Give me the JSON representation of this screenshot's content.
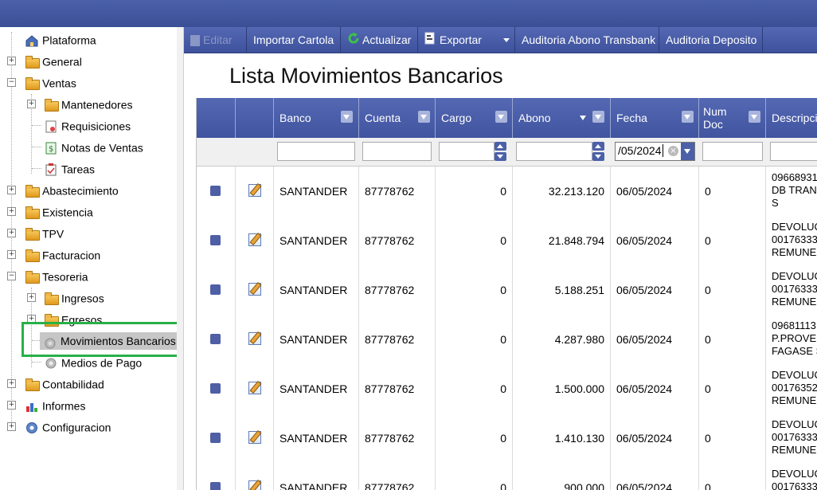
{
  "sidebar": {
    "items": [
      {
        "label": "Plataforma",
        "icon": "house-icon"
      },
      {
        "label": "General",
        "icon": "folder-icon"
      },
      {
        "label": "Ventas",
        "icon": "folder-icon"
      },
      {
        "label": "Mantenedores",
        "icon": "folder-icon"
      },
      {
        "label": "Requisiciones",
        "icon": "document-icon"
      },
      {
        "label": "Notas de Ventas",
        "icon": "money-icon"
      },
      {
        "label": "Tareas",
        "icon": "clipboard-icon"
      },
      {
        "label": "Abastecimiento",
        "icon": "folder-icon"
      },
      {
        "label": "Existencia",
        "icon": "folder-icon"
      },
      {
        "label": "TPV",
        "icon": "folder-icon"
      },
      {
        "label": "Facturacion",
        "icon": "folder-icon"
      },
      {
        "label": "Tesoreria",
        "icon": "folder-icon"
      },
      {
        "label": "Ingresos",
        "icon": "folder-icon"
      },
      {
        "label": "Egresos",
        "icon": "folder-icon"
      },
      {
        "label": "Movimientos Bancarios",
        "icon": "gear-icon"
      },
      {
        "label": "Medios de Pago",
        "icon": "gear-icon"
      },
      {
        "label": "Contabilidad",
        "icon": "folder-icon"
      },
      {
        "label": "Informes",
        "icon": "bar-chart-icon"
      },
      {
        "label": "Configuracion",
        "icon": "gear-icon"
      }
    ]
  },
  "toolbar": {
    "editar": "Editar",
    "importar": "Importar Cartola",
    "actualizar": "Actualizar",
    "exportar": "Exportar",
    "auditoria_abono": "Auditoria Abono Transbank",
    "auditoria_deposito": "Auditoria Deposito"
  },
  "page": {
    "title": "Lista Movimientos Bancarios"
  },
  "grid": {
    "columns": {
      "banco": "Banco",
      "cuenta": "Cuenta",
      "cargo": "Cargo",
      "abono": "Abono",
      "fecha": "Fecha",
      "num_doc_1": "Num",
      "num_doc_2": "Doc",
      "descripcion": "Descripcio"
    },
    "filters": {
      "fecha": "/05/2024"
    },
    "rows": [
      {
        "banco": "SANTANDER",
        "cuenta": "87778762",
        "cargo": "0",
        "abono": "32.213.120",
        "fecha": "06/05/2024",
        "num_doc": "0",
        "desc": [
          "09668931",
          "DB TRAN",
          "S"
        ]
      },
      {
        "banco": "SANTANDER",
        "cuenta": "87778762",
        "cargo": "0",
        "abono": "21.848.794",
        "fecha": "06/05/2024",
        "num_doc": "0",
        "desc": [
          "DEVOLUC",
          "00176333",
          "REMUNER"
        ]
      },
      {
        "banco": "SANTANDER",
        "cuenta": "87778762",
        "cargo": "0",
        "abono": "5.188.251",
        "fecha": "06/05/2024",
        "num_doc": "0",
        "desc": [
          "DEVOLUC",
          "00176333",
          "REMUNER"
        ]
      },
      {
        "banco": "SANTANDER",
        "cuenta": "87778762",
        "cargo": "0",
        "abono": "4.287.980",
        "fecha": "06/05/2024",
        "num_doc": "0",
        "desc": [
          "09681113",
          "P.PROVEE",
          "FAGASE S"
        ]
      },
      {
        "banco": "SANTANDER",
        "cuenta": "87778762",
        "cargo": "0",
        "abono": "1.500.000",
        "fecha": "06/05/2024",
        "num_doc": "0",
        "desc": [
          "DEVOLUC",
          "00176352",
          "REMUNER"
        ]
      },
      {
        "banco": "SANTANDER",
        "cuenta": "87778762",
        "cargo": "0",
        "abono": "1.410.130",
        "fecha": "06/05/2024",
        "num_doc": "0",
        "desc": [
          "DEVOLUC",
          "00176333",
          "REMUNER"
        ]
      },
      {
        "banco": "SANTANDER",
        "cuenta": "87778762",
        "cargo": "0",
        "abono": "900.000",
        "fecha": "06/05/2024",
        "num_doc": "0",
        "desc": [
          "DEVOLUC",
          "00176333",
          ""
        ]
      }
    ]
  },
  "colors": {
    "accent": "#4a5fa8",
    "highlight": "#28b048",
    "selected_bg": "#c6c6c6"
  }
}
